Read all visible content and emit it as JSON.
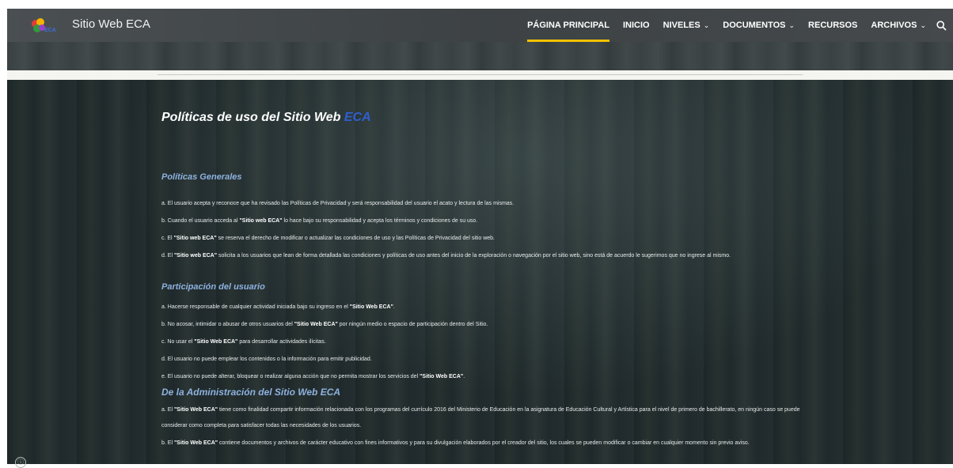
{
  "header": {
    "site_title": "Sitio Web ECA",
    "logo_text": "ECA",
    "nav": [
      {
        "label": "PÁGINA PRINCIPAL",
        "active": true,
        "has_dropdown": false
      },
      {
        "label": "INICIO",
        "active": false,
        "has_dropdown": false
      },
      {
        "label": "NIVELES",
        "active": false,
        "has_dropdown": true
      },
      {
        "label": "DOCUMENTOS",
        "active": false,
        "has_dropdown": true
      },
      {
        "label": "RECURSOS",
        "active": false,
        "has_dropdown": false
      },
      {
        "label": "ARCHIVOS",
        "active": false,
        "has_dropdown": true
      }
    ],
    "search_icon": "search-icon",
    "chevron_glyph": "⌄",
    "search_glyph": "🔍"
  },
  "main": {
    "title_prefix": "Políticas de uso del Sitio Web",
    "title_accent": "ECA",
    "sections": [
      {
        "heading": "Políticas Generales",
        "items": [
          "a. El usuario acepta y reconoce que ha revisado las Políticas de Privacidad y será responsabilidad del usuario el acato y lectura de las mismas.",
          "b. Cuando el usuario acceda al \"Sitio web ECA\" lo hace bajo su responsabilidad y acepta los términos y condiciones de su uso.",
          "c. El \"Sitio web ECA\" se reserva el derecho de modificar o actualizar las condiciones de uso y las Políticas de Privacidad del sitio web.",
          "d. El \"Sitio web ECA\" solicita a los usuarios que lean de forma detallada las condiciones y políticas de uso antes del inicio de la exploración o navegación por el sitio web, sino está de acuerdo le sugerimos que no ingrese al mismo."
        ]
      },
      {
        "heading": "Participación del usuario",
        "items": [
          "a. Hacerse responsable de cualquier actividad iniciada bajo su ingreso en el \"Sitio Web ECA\".",
          "b. No acosar, intimidar o abusar de otros usuarios del \"Sitio Web ECA\" por ningún medio o espacio de participación dentro del Sitio.",
          "c. No usar el \"Sitio Web ECA\" para desarrollar actividades ilícitas.",
          "d. El usuario no puede emplear los contenidos o la información para emitir publicidad.",
          "e. El usuario no puede alterar, bloquear o realizar alguna acción que no permita mostrar los servicios del \"Sitio Web ECA\"."
        ]
      },
      {
        "heading": "De la Administración del Sitio Web ECA",
        "items": [
          "a. El \"Sitio Web ECA\" tiene como finalidad compartir información relacionada con los programas del currículo 2016 del Ministerio de Educación en la asignatura de Educación Cultural y Artística para el nivel de primero de bachillerato, en ningún caso se puede considerar como completa para satisfacer todas las necesidades de los usuarios.",
          "b. El \"Sitio Web ECA\" contiene documentos y archivos de carácter educativo con fines informativos y para su divulgación elaborados por el creador del sitio, los cuales se pueden modificar o cambiar en cualquier momento sin previo aviso."
        ]
      }
    ]
  },
  "footer": {
    "info_icon": "info-icon",
    "info_glyph": "ⓘ"
  },
  "colors": {
    "accent_yellow": "#f2c200",
    "heading_blue": "#8eb2e0",
    "title_accent_blue": "#2e5fd1"
  }
}
